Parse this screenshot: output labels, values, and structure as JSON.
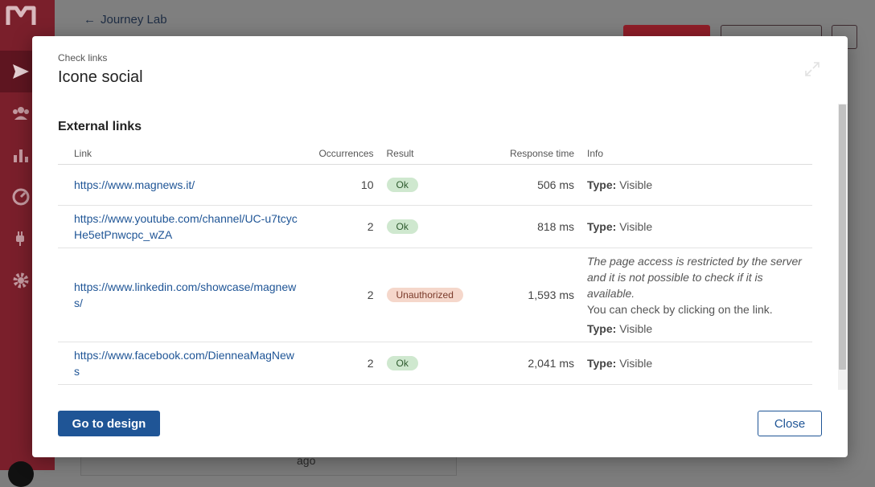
{
  "app": {
    "back_label": "Journey Lab",
    "bg_ago": "ago",
    "colors": {
      "sidebar": "#7a1f2b",
      "accent": "#1f5596",
      "send": "#8f1e28"
    }
  },
  "sidebar": {
    "items": [
      {
        "icon": "send-icon",
        "active": true
      },
      {
        "icon": "users-icon"
      },
      {
        "icon": "bar-chart-icon"
      },
      {
        "icon": "gauge-icon"
      },
      {
        "icon": "plug-icon"
      },
      {
        "icon": "gear-icon"
      }
    ]
  },
  "modal": {
    "subtitle": "Check links",
    "title": "Icone social",
    "section_title": "External links",
    "columns": {
      "link": "Link",
      "occurrences": "Occurrences",
      "result": "Result",
      "response_time": "Response time",
      "info": "Info"
    },
    "rows": [
      {
        "link": "https://www.magnews.it/",
        "occurrences": "10",
        "result": "Ok",
        "time": "506 ms",
        "type_label": "Type:",
        "type_value": " Visible"
      },
      {
        "link": "https://www.youtube.com/channel/UC-u7tcycHe5etPnwcpc_wZA",
        "occurrences": "2",
        "result": "Ok",
        "time": "818 ms",
        "type_label": "Type:",
        "type_value": " Visible"
      },
      {
        "link": "https://www.linkedin.com/showcase/magnews/",
        "occurrences": "2",
        "result": "Unauthorized",
        "time": "1,593 ms",
        "note": "The page access is restricted by the server and it is not possible to check if it is available.",
        "hint": "You can check by clicking on the link.",
        "type_label": "Type:",
        "type_value": " Visible"
      },
      {
        "link": "https://www.facebook.com/DienneaMagNews",
        "occurrences": "2",
        "result": "Ok",
        "time": "2,041 ms",
        "type_label": "Type:",
        "type_value": " Visible"
      }
    ],
    "primary_button": "Go to design",
    "close_button": "Close"
  }
}
